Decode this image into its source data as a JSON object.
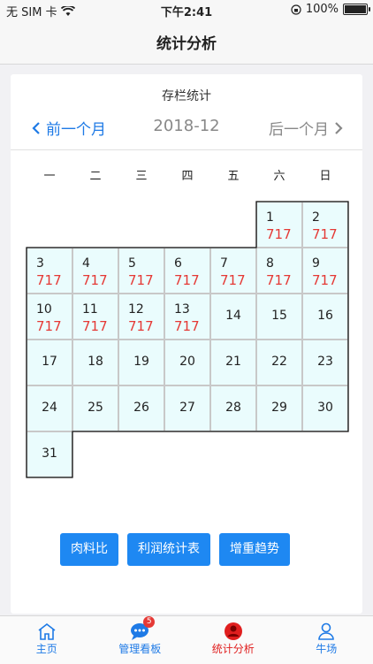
{
  "status_bar": {
    "carrier": "无 SIM 卡",
    "time": "下午2:41",
    "battery": "100%"
  },
  "nav": {
    "title": "统计分析"
  },
  "card": {
    "title": "存栏统计",
    "prev_label": "前一个月",
    "current_month": "2018-12",
    "next_label": "后一个月"
  },
  "calendar": {
    "weekdays": [
      "一",
      "二",
      "三",
      "四",
      "五",
      "六",
      "日"
    ],
    "days": [
      {
        "day": "1",
        "value": "717"
      },
      {
        "day": "2",
        "value": "717"
      },
      {
        "day": "3",
        "value": "717"
      },
      {
        "day": "4",
        "value": "717"
      },
      {
        "day": "5",
        "value": "717"
      },
      {
        "day": "6",
        "value": "717"
      },
      {
        "day": "7",
        "value": "717"
      },
      {
        "day": "8",
        "value": "717"
      },
      {
        "day": "9",
        "value": "717"
      },
      {
        "day": "10",
        "value": "717"
      },
      {
        "day": "11",
        "value": "717"
      },
      {
        "day": "12",
        "value": "717"
      },
      {
        "day": "13",
        "value": "717"
      },
      {
        "day": "14",
        "value": ""
      },
      {
        "day": "15",
        "value": ""
      },
      {
        "day": "16",
        "value": ""
      },
      {
        "day": "17",
        "value": ""
      },
      {
        "day": "18",
        "value": ""
      },
      {
        "day": "19",
        "value": ""
      },
      {
        "day": "20",
        "value": ""
      },
      {
        "day": "21",
        "value": ""
      },
      {
        "day": "22",
        "value": ""
      },
      {
        "day": "23",
        "value": ""
      },
      {
        "day": "24",
        "value": ""
      },
      {
        "day": "25",
        "value": ""
      },
      {
        "day": "26",
        "value": ""
      },
      {
        "day": "27",
        "value": ""
      },
      {
        "day": "28",
        "value": ""
      },
      {
        "day": "29",
        "value": ""
      },
      {
        "day": "30",
        "value": ""
      },
      {
        "day": "31",
        "value": ""
      }
    ]
  },
  "actions": [
    "肉料比",
    "利润统计表",
    "增重趋势"
  ],
  "tabbar": {
    "items": [
      {
        "label": "主页",
        "icon": "home-icon"
      },
      {
        "label": "管理看板",
        "icon": "chat-bubble-icon",
        "badge": "5"
      },
      {
        "label": "统计分析",
        "icon": "profile-circle-icon"
      },
      {
        "label": "牛场",
        "icon": "person-icon"
      }
    ]
  },
  "colors": {
    "accent": "#1e88f2",
    "highlight": "#e53935",
    "cell_bg": "#eafcfd"
  }
}
